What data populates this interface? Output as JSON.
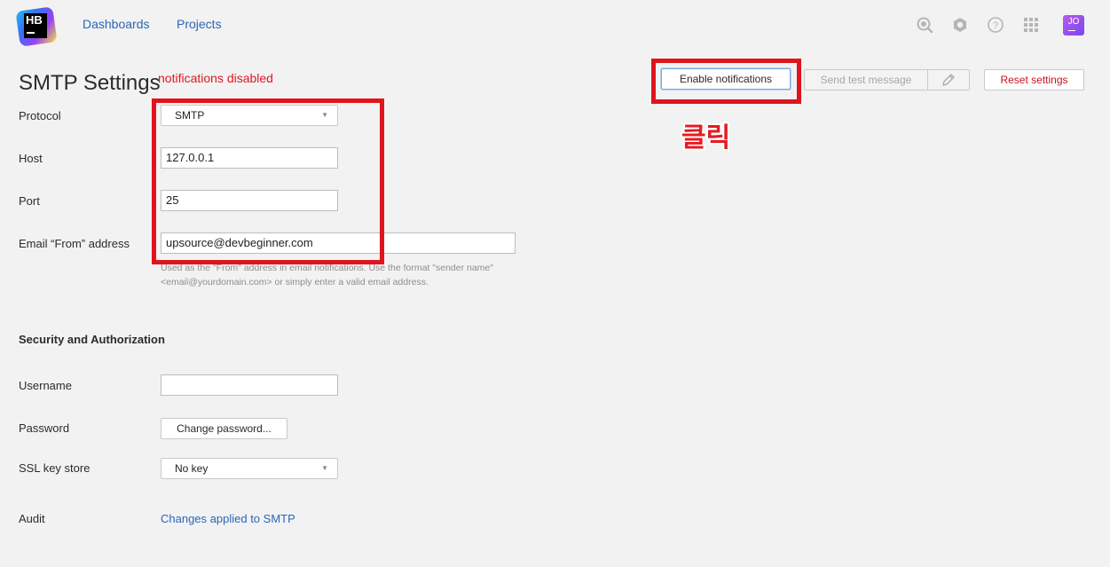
{
  "header": {
    "logo_text": "HB",
    "nav": [
      "Dashboards",
      "Projects"
    ],
    "icons": [
      "search-icon",
      "hexagon-icon",
      "help-icon",
      "apps-grid-icon"
    ],
    "avatar_initials": "JO"
  },
  "title": "SMTP Settings",
  "status_note": "notifications disabled",
  "actions": {
    "enable": "Enable notifications",
    "send_test": "Send test message",
    "reset": "Reset settings"
  },
  "annotation": "클릭",
  "form": {
    "protocol": {
      "label": "Protocol",
      "value": "SMTP"
    },
    "host": {
      "label": "Host",
      "value": "127.0.0.1"
    },
    "port": {
      "label": "Port",
      "value": "25"
    },
    "email_from": {
      "label": "Email “From” address",
      "value": "upsource@devbeginner.com",
      "hint": "Used as the \"From\" address in email notifications. Use the format \"sender name\" <email@yourdomain.com> or simply enter a valid email address."
    }
  },
  "security": {
    "title": "Security and Authorization",
    "username": {
      "label": "Username",
      "value": ""
    },
    "password": {
      "label": "Password",
      "button": "Change password..."
    },
    "ssl": {
      "label": "SSL key store",
      "value": "No key"
    },
    "audit": {
      "label": "Audit",
      "link": "Changes applied to SMTP"
    }
  },
  "colors": {
    "accent_link": "#2a66b7",
    "warning_red": "#e0171f",
    "annotation_red": "#e0141c"
  }
}
